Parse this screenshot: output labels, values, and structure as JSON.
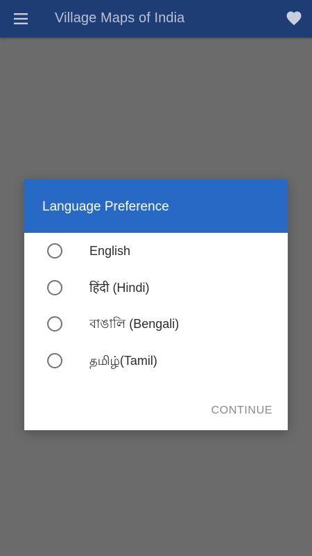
{
  "appbar": {
    "title": "Village Maps of India",
    "menu_icon": "hamburger-menu-icon",
    "favorite_icon": "heart-icon"
  },
  "dialog": {
    "title": "Language Preference",
    "options": [
      {
        "label": "English",
        "selected": false
      },
      {
        "label": "हिंदी (Hindi)",
        "selected": false
      },
      {
        "label": "বাঙালি (Bengali)",
        "selected": false
      },
      {
        "label": "தமிழ்(Tamil)",
        "selected": false
      }
    ],
    "continue_label": "CONTINUE"
  },
  "colors": {
    "appbar": "#1d3d74",
    "appbar_title": "#b9c2d3",
    "dialog_header": "#276ac6",
    "scrim": "#6b6b6b",
    "continue_text": "#8a8a8a"
  }
}
